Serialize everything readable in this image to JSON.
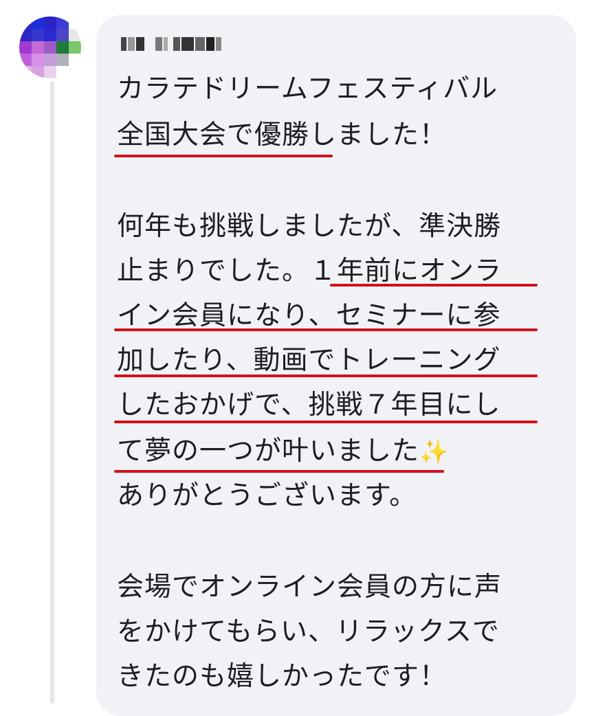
{
  "comment": {
    "author_name_pixelated": true,
    "lines": [
      "カラテドリームフェスティバル",
      "全国大会で優勝しました！",
      "何年も挑戦しましたが、準決勝",
      "止まりでした。１年前にオンラ",
      "イン会員になり、セミナーに参",
      "加したり、動画でトレーニング",
      "したおかげで、挑戦７年目にし",
      "て夢の一つが叶いました",
      "ありがとうございます。",
      "会場でオンライン会員の方に声",
      "をかけてもらい、リラックスで",
      "きたのも嬉しかったです！"
    ],
    "sparkle_emoji": "✨"
  },
  "colors": {
    "bubble": "#f0f2f5",
    "text": "#1c1e21",
    "underline": "#d40f1d",
    "thread_line": "#e4e6ea"
  }
}
